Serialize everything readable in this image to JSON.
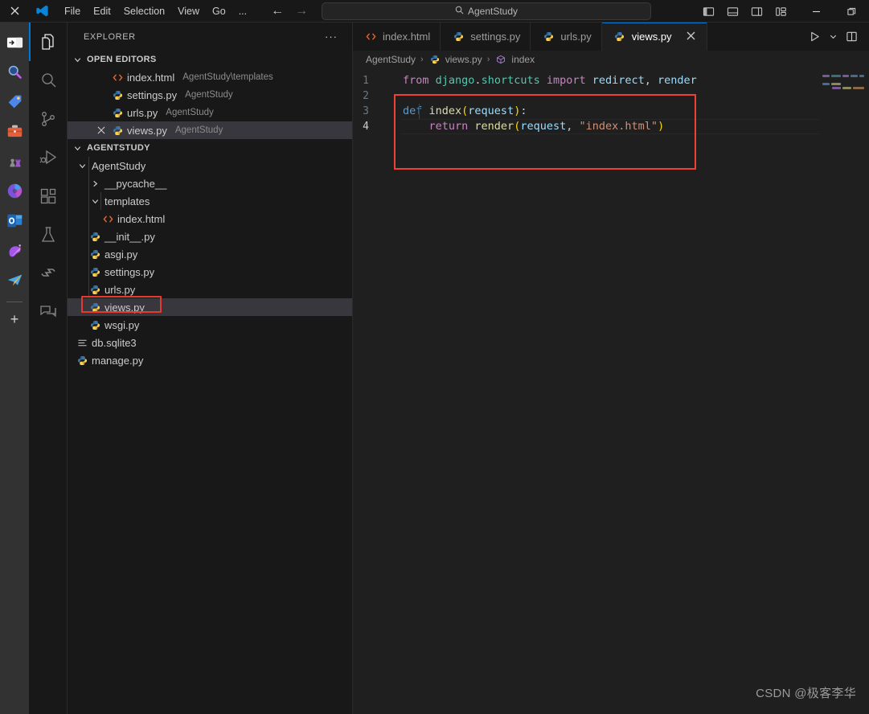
{
  "titlebar": {
    "close_label": "✕",
    "menu": [
      "File",
      "Edit",
      "Selection",
      "View",
      "Go",
      "..."
    ],
    "back_label": "←",
    "forward_label": "→",
    "search_icon": "search-icon",
    "search_text": "AgentStudy",
    "layout_buttons": [
      {
        "name": "toggle-primary-sidebar",
        "title": "Toggle Primary Side Bar"
      },
      {
        "name": "toggle-panel",
        "title": "Toggle Panel"
      },
      {
        "name": "toggle-secondary-sidebar",
        "title": "Toggle Secondary Side Bar"
      },
      {
        "name": "customize-layout",
        "title": "Customize Layout"
      }
    ],
    "minimize_label": "—",
    "restore_label": "❐"
  },
  "apprail": {
    "items": [
      {
        "name": "pin-taskbar-icon",
        "label": "→|"
      },
      {
        "name": "search-app-icon",
        "label": "search"
      },
      {
        "name": "tag-app-icon",
        "label": "tag"
      },
      {
        "name": "briefcase-app-icon",
        "label": "briefcase"
      },
      {
        "name": "chess-app-icon",
        "label": "chess"
      },
      {
        "name": "microsoft365-app-icon",
        "label": "Microsoft 365"
      },
      {
        "name": "outlook-app-icon",
        "label": "Outlook"
      },
      {
        "name": "copilot-app-icon",
        "label": "Copilot"
      },
      {
        "name": "telegram-app-icon",
        "label": "Telegram"
      }
    ],
    "add_label": "+"
  },
  "activitybar": {
    "items": [
      {
        "name": "activity-explorer",
        "label": "Explorer",
        "active": true
      },
      {
        "name": "activity-search",
        "label": "Search",
        "active": false
      },
      {
        "name": "activity-source-control",
        "label": "Source Control",
        "active": false
      },
      {
        "name": "activity-run-debug",
        "label": "Run and Debug",
        "active": false
      },
      {
        "name": "activity-extensions",
        "label": "Extensions",
        "active": false
      },
      {
        "name": "activity-testing",
        "label": "Testing",
        "active": false
      },
      {
        "name": "activity-sourcery",
        "label": "Sourcery",
        "active": false
      },
      {
        "name": "activity-chat",
        "label": "Chat",
        "active": false
      }
    ]
  },
  "sidebar": {
    "title": "EXPLORER",
    "more_label": "···",
    "open_editors": {
      "title": "OPEN EDITORS",
      "items": [
        {
          "name": "index.html",
          "desc": "AgentStudy\\templates",
          "icon": "html-icon",
          "active": false
        },
        {
          "name": "settings.py",
          "desc": "AgentStudy",
          "icon": "python-icon",
          "active": false
        },
        {
          "name": "urls.py",
          "desc": "AgentStudy",
          "icon": "python-icon",
          "active": false
        },
        {
          "name": "views.py",
          "desc": "AgentStudy",
          "icon": "python-icon",
          "active": true
        }
      ]
    },
    "project": {
      "title": "AGENTSTUDY",
      "tree": [
        {
          "label": "AgentStudy",
          "type": "folder",
          "indent": 1,
          "expanded": true
        },
        {
          "label": "__pycache__",
          "type": "folder",
          "indent": 2,
          "expanded": false
        },
        {
          "label": "templates",
          "type": "folder",
          "indent": 2,
          "expanded": true
        },
        {
          "label": "index.html",
          "type": "html",
          "indent": 3
        },
        {
          "label": "__init__.py",
          "type": "python",
          "indent": 2
        },
        {
          "label": "asgi.py",
          "type": "python",
          "indent": 2
        },
        {
          "label": "settings.py",
          "type": "python",
          "indent": 2
        },
        {
          "label": "urls.py",
          "type": "python",
          "indent": 2
        },
        {
          "label": "views.py",
          "type": "python",
          "indent": 2,
          "selected": true,
          "highlighted": true
        },
        {
          "label": "wsgi.py",
          "type": "python",
          "indent": 2
        },
        {
          "label": "db.sqlite3",
          "type": "database",
          "indent": 1
        },
        {
          "label": "manage.py",
          "type": "python",
          "indent": 1
        }
      ]
    }
  },
  "editor": {
    "tabs": [
      {
        "label": "index.html",
        "icon": "html-icon",
        "active": false,
        "closable": false
      },
      {
        "label": "settings.py",
        "icon": "python-icon",
        "active": false,
        "closable": false
      },
      {
        "label": "urls.py",
        "icon": "python-icon",
        "active": false,
        "closable": false
      },
      {
        "label": "views.py",
        "icon": "python-icon",
        "active": true,
        "closable": true,
        "close_label": "✕"
      }
    ],
    "actions": [
      {
        "name": "run-python-file-button",
        "label": "run"
      },
      {
        "name": "run-options-chevron-icon",
        "label": "⌄"
      },
      {
        "name": "split-editor-right-button",
        "label": "split"
      }
    ],
    "breadcrumb": [
      {
        "label": "AgentStudy",
        "icon": "folder-icon"
      },
      {
        "label": "views.py",
        "icon": "python-icon"
      },
      {
        "label": "index",
        "icon": "symbol-method-icon"
      }
    ],
    "breadcrumb_separator": "›",
    "lines": [
      {
        "num": "1",
        "current": false,
        "tokens": [
          {
            "t": "from ",
            "c": "t-kw"
          },
          {
            "t": "django",
            "c": "t-mod"
          },
          {
            "t": ".",
            "c": "t-pun"
          },
          {
            "t": "shortcuts ",
            "c": "t-mod"
          },
          {
            "t": "import ",
            "c": "t-kw"
          },
          {
            "t": "redirect",
            "c": "t-var"
          },
          {
            "t": ", ",
            "c": "t-pun"
          },
          {
            "t": "render",
            "c": "t-var"
          }
        ]
      },
      {
        "num": "2",
        "current": false,
        "tokens": []
      },
      {
        "num": "3",
        "current": false,
        "tokens": [
          {
            "t": "def ",
            "c": "t-kw2"
          },
          {
            "t": "index",
            "c": "t-fn"
          },
          {
            "t": "(",
            "c": "t-br"
          },
          {
            "t": "request",
            "c": "t-var"
          },
          {
            "t": ")",
            "c": "t-br"
          },
          {
            "t": ":",
            "c": "t-pun"
          }
        ]
      },
      {
        "num": "4",
        "current": true,
        "tokens": [
          {
            "t": "    ",
            "c": "t-pun"
          },
          {
            "t": "return ",
            "c": "t-kw"
          },
          {
            "t": "render",
            "c": "t-fn"
          },
          {
            "t": "(",
            "c": "t-br"
          },
          {
            "t": "request",
            "c": "t-var"
          },
          {
            "t": ", ",
            "c": "t-pun"
          },
          {
            "t": "\"index.html\"",
            "c": "t-str"
          },
          {
            "t": ")",
            "c": "t-br"
          }
        ]
      }
    ],
    "annotation_color": "#ef4136"
  },
  "watermark": "CSDN @极客李华",
  "colors": {
    "accent": "#0078d4",
    "annotation": "#ef4136",
    "editor_bg": "#1f1f1f",
    "sidebar_bg": "#181818",
    "selected_row": "#37373d"
  }
}
